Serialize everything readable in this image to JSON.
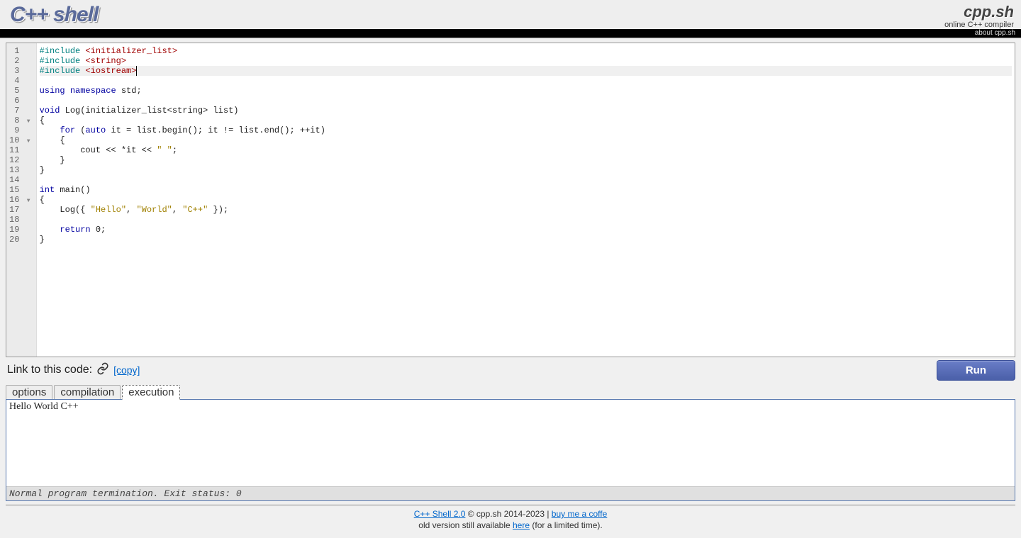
{
  "header": {
    "logo": "C++ shell",
    "brand_title": "cpp.sh",
    "brand_sub": "online C++ compiler",
    "about": "about cpp.sh"
  },
  "editor": {
    "gutter": [
      "1",
      "2",
      "3",
      "4",
      "5",
      "6",
      "7",
      "8",
      "9",
      "10",
      "11",
      "12",
      "13",
      "14",
      "15",
      "16",
      "17",
      "18",
      "19",
      "20"
    ],
    "fold_lines": [
      8,
      10,
      16
    ],
    "active_line": 3,
    "code_tokens": [
      [
        {
          "c": "pp",
          "t": "#include "
        },
        {
          "c": "inc",
          "t": "<initializer_list>"
        }
      ],
      [
        {
          "c": "pp",
          "t": "#include "
        },
        {
          "c": "inc",
          "t": "<string>"
        }
      ],
      [
        {
          "c": "pp",
          "t": "#include "
        },
        {
          "c": "inc",
          "t": "<iostream>"
        }
      ],
      [
        {
          "c": "",
          "t": ""
        }
      ],
      [
        {
          "c": "kw",
          "t": "using "
        },
        {
          "c": "kw",
          "t": "namespace "
        },
        {
          "c": "",
          "t": "std;"
        }
      ],
      [
        {
          "c": "",
          "t": ""
        }
      ],
      [
        {
          "c": "kw",
          "t": "void "
        },
        {
          "c": "",
          "t": "Log(initializer_list<string> list)"
        }
      ],
      [
        {
          "c": "",
          "t": "{"
        }
      ],
      [
        {
          "c": "",
          "t": "    "
        },
        {
          "c": "kw",
          "t": "for "
        },
        {
          "c": "",
          "t": "("
        },
        {
          "c": "kw",
          "t": "auto "
        },
        {
          "c": "",
          "t": "it = list.begin(); it != list.end(); ++it)"
        }
      ],
      [
        {
          "c": "",
          "t": "    {"
        }
      ],
      [
        {
          "c": "",
          "t": "        cout << *it << "
        },
        {
          "c": "str",
          "t": "\" \""
        },
        {
          "c": "",
          "t": ";"
        }
      ],
      [
        {
          "c": "",
          "t": "    }"
        }
      ],
      [
        {
          "c": "",
          "t": "}"
        }
      ],
      [
        {
          "c": "",
          "t": ""
        }
      ],
      [
        {
          "c": "kw",
          "t": "int "
        },
        {
          "c": "",
          "t": "main()"
        }
      ],
      [
        {
          "c": "",
          "t": "{"
        }
      ],
      [
        {
          "c": "",
          "t": "    Log({ "
        },
        {
          "c": "str",
          "t": "\"Hello\""
        },
        {
          "c": "",
          "t": ", "
        },
        {
          "c": "str",
          "t": "\"World\""
        },
        {
          "c": "",
          "t": ", "
        },
        {
          "c": "str",
          "t": "\"C++\""
        },
        {
          "c": "",
          "t": " });"
        }
      ],
      [
        {
          "c": "",
          "t": ""
        }
      ],
      [
        {
          "c": "",
          "t": "    "
        },
        {
          "c": "kw",
          "t": "return "
        },
        {
          "c": "",
          "t": "0;"
        }
      ],
      [
        {
          "c": "",
          "t": "}"
        }
      ]
    ]
  },
  "linkbar": {
    "label": "Link to this code:",
    "copy": "[copy]",
    "run": "Run"
  },
  "tabs": [
    "options",
    "compilation",
    "execution"
  ],
  "active_tab": 2,
  "output": {
    "body": "Hello World C++ ",
    "status": "Normal program termination. Exit status: 0"
  },
  "footer": {
    "l1_a": "C++ Shell 2.0",
    "l1_b": " © cpp.sh 2014-2023 | ",
    "l1_c": "buy me a coffe",
    "l2_a": "old version still available ",
    "l2_b": "here",
    "l2_c": " (for a limited time)."
  }
}
